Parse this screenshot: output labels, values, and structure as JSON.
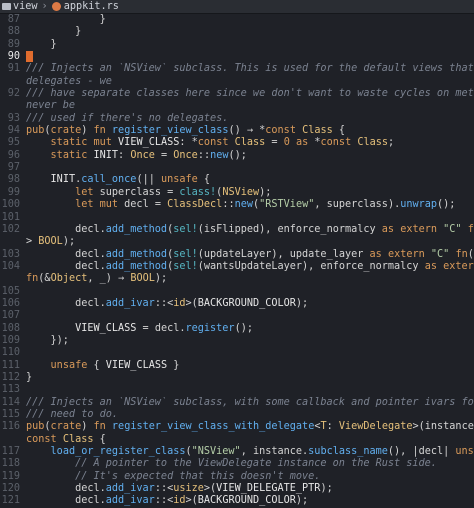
{
  "breadcrumb": {
    "folder": "view",
    "file": "appkit.rs"
  },
  "colors": {
    "cursor": "#e06c2e",
    "rust_icon": "#dd7a45",
    "comment": "#7b8290",
    "keyword": "#d99a5a"
  },
  "lines": [
    {
      "n": "87",
      "t": "            }"
    },
    {
      "n": "88",
      "t": "        }"
    },
    {
      "n": "89",
      "t": "    }"
    },
    {
      "n": "90",
      "t": "",
      "cursor": true
    },
    {
      "n": "91",
      "t": "/// Injects an `NSView` subclass. This is used for the default views that don't use",
      "c": "cm"
    },
    {
      "n": "",
      "t": "delegates - we",
      "c": "cm"
    },
    {
      "n": "92",
      "t": "/// have separate classes here since we don't want to waste cycles on methods that will",
      "c": "cm"
    },
    {
      "n": "",
      "t": "never be",
      "c": "cm"
    },
    {
      "n": "93",
      "t": "/// used if there's no delegates.",
      "c": "cm"
    },
    {
      "n": "94",
      "t": "pub(crate) fn register_view_class() → *const Class {"
    },
    {
      "n": "95",
      "t": "    static mut VIEW_CLASS: *const Class = 0 as *const Class;"
    },
    {
      "n": "96",
      "t": "    static INIT: Once = Once::new();"
    },
    {
      "n": "97",
      "t": ""
    },
    {
      "n": "98",
      "t": "    INIT.call_once(|| unsafe {"
    },
    {
      "n": "99",
      "t": "        let superclass = class!(NSView);"
    },
    {
      "n": "100",
      "t": "        let mut decl = ClassDecl::new(\"RSTView\", superclass).unwrap();"
    },
    {
      "n": "101",
      "t": ""
    },
    {
      "n": "102",
      "t": "        decl.add_method(sel!(isFlipped), enforce_normalcy as extern \"C\" fn(&Object, _) -"
    },
    {
      "n": "",
      "t": "> BOOL);"
    },
    {
      "n": "103",
      "t": "        decl.add_method(sel!(updateLayer), update_layer as extern \"C\" fn(&Object, _));"
    },
    {
      "n": "104",
      "t": "        decl.add_method(sel!(wantsUpdateLayer), enforce_normalcy as extern \"C\""
    },
    {
      "n": "",
      "t": "fn(&Object, _) → BOOL);"
    },
    {
      "n": "105",
      "t": ""
    },
    {
      "n": "106",
      "t": "        decl.add_ivar::<id>(BACKGROUND_COLOR);"
    },
    {
      "n": "107",
      "t": ""
    },
    {
      "n": "108",
      "t": "        VIEW_CLASS = decl.register();"
    },
    {
      "n": "109",
      "t": "    });"
    },
    {
      "n": "110",
      "t": ""
    },
    {
      "n": "111",
      "t": "    unsafe { VIEW_CLASS }"
    },
    {
      "n": "112",
      "t": "}"
    },
    {
      "n": "113",
      "t": ""
    },
    {
      "n": "114",
      "t": "/// Injects an `NSView` subclass, with some callback and pointer ivars for what we",
      "c": "cm"
    },
    {
      "n": "115",
      "t": "/// need to do.",
      "c": "cm"
    },
    {
      "n": "116",
      "t": "pub(crate) fn register_view_class_with_delegate<T: ViewDelegate>(instance: &T) → *"
    },
    {
      "n": "",
      "t": "const Class {"
    },
    {
      "n": "117",
      "t": "    load_or_register_class(\"NSView\", instance.subclass_name(), |decl| unsafe {"
    },
    {
      "n": "118",
      "t": "        // A pointer to the ViewDelegate instance on the Rust side.",
      "c": "cm"
    },
    {
      "n": "119",
      "t": "        // It's expected that this doesn't move.",
      "c": "cm"
    },
    {
      "n": "120",
      "t": "        decl.add_ivar::<usize>(VIEW_DELEGATE_PTR);"
    },
    {
      "n": "121",
      "t": "        decl.add_ivar::<id>(BACKGROUND_COLOR);"
    }
  ]
}
